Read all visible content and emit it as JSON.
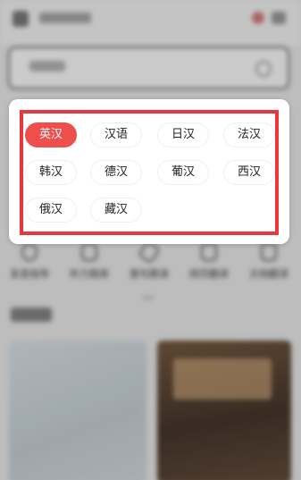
{
  "toolbar": {
    "items": [
      {
        "label": "发音指导",
        "icon": "ear-icon"
      },
      {
        "label": "听力题库",
        "icon": "headphones-icon"
      },
      {
        "label": "壹句跟读",
        "icon": "pen-icon"
      },
      {
        "label": "网页翻译",
        "icon": "web-translate-icon"
      },
      {
        "label": "文档翻译",
        "icon": "document-icon"
      }
    ]
  },
  "language_menu": {
    "selected": "英汉",
    "options": [
      "英汉",
      "汉语",
      "日汉",
      "法汉",
      "韩汉",
      "德汉",
      "葡汉",
      "西汉",
      "俄汉",
      "藏汉"
    ]
  },
  "colors": {
    "accent": "#ee4f4c",
    "highlight_border": "#e8383d"
  }
}
